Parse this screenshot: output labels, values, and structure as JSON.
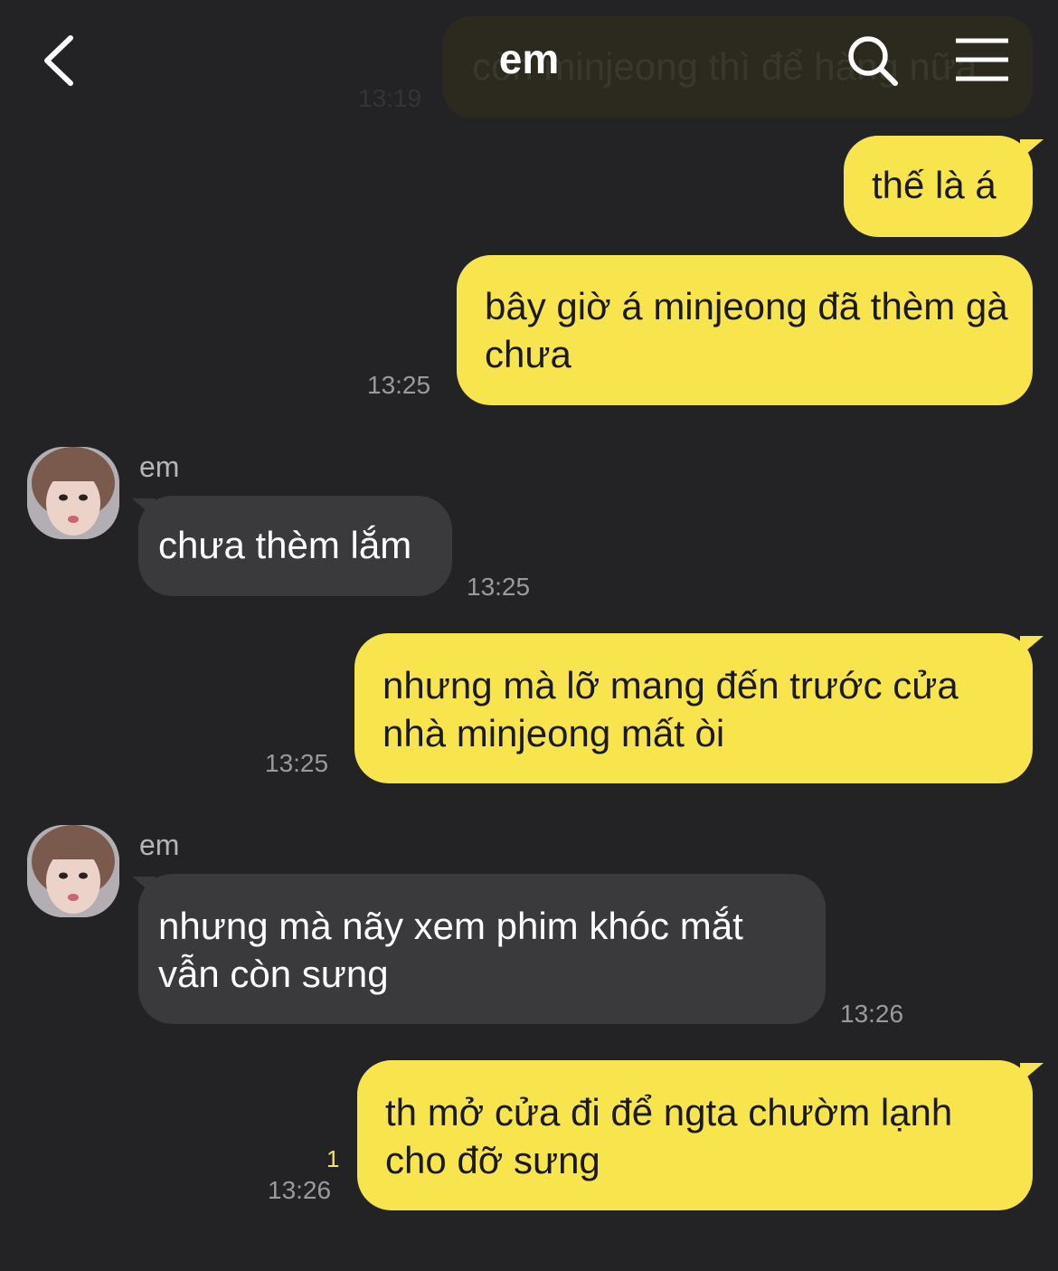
{
  "header": {
    "title": "em",
    "icons": {
      "back": "chevron-left-icon",
      "search": "search-icon",
      "menu": "hamburger-menu-icon"
    }
  },
  "previous_message": {
    "text": "còn minjeong thì để hàng nữa",
    "time": "13:19"
  },
  "messages": [
    {
      "direction": "outgoing",
      "text": "thế là á",
      "time": ""
    },
    {
      "direction": "outgoing",
      "text": "bây giờ á minjeong đã thèm gà chưa",
      "time": "13:25"
    },
    {
      "direction": "incoming",
      "sender": "em",
      "text": "chưa thèm lắm",
      "time": "13:25"
    },
    {
      "direction": "outgoing",
      "text": "nhưng mà lỡ mang đến trước cửa nhà minjeong mất òi",
      "time": "13:25"
    },
    {
      "direction": "incoming",
      "sender": "em",
      "text": "nhưng mà nãy xem phim khóc mắt vẫn còn sưng",
      "time": "13:26"
    },
    {
      "direction": "outgoing",
      "text": "th mở cửa đi để ngta chườm lạnh cho đỡ sưng",
      "time": "13:26",
      "unread_count": "1"
    }
  ],
  "colors": {
    "background": "#232325",
    "outgoing_bubble": "#f8e54d",
    "incoming_bubble": "#3a3a3c",
    "timestamp": "#9a9a9c",
    "unread": "#f8e54d"
  }
}
